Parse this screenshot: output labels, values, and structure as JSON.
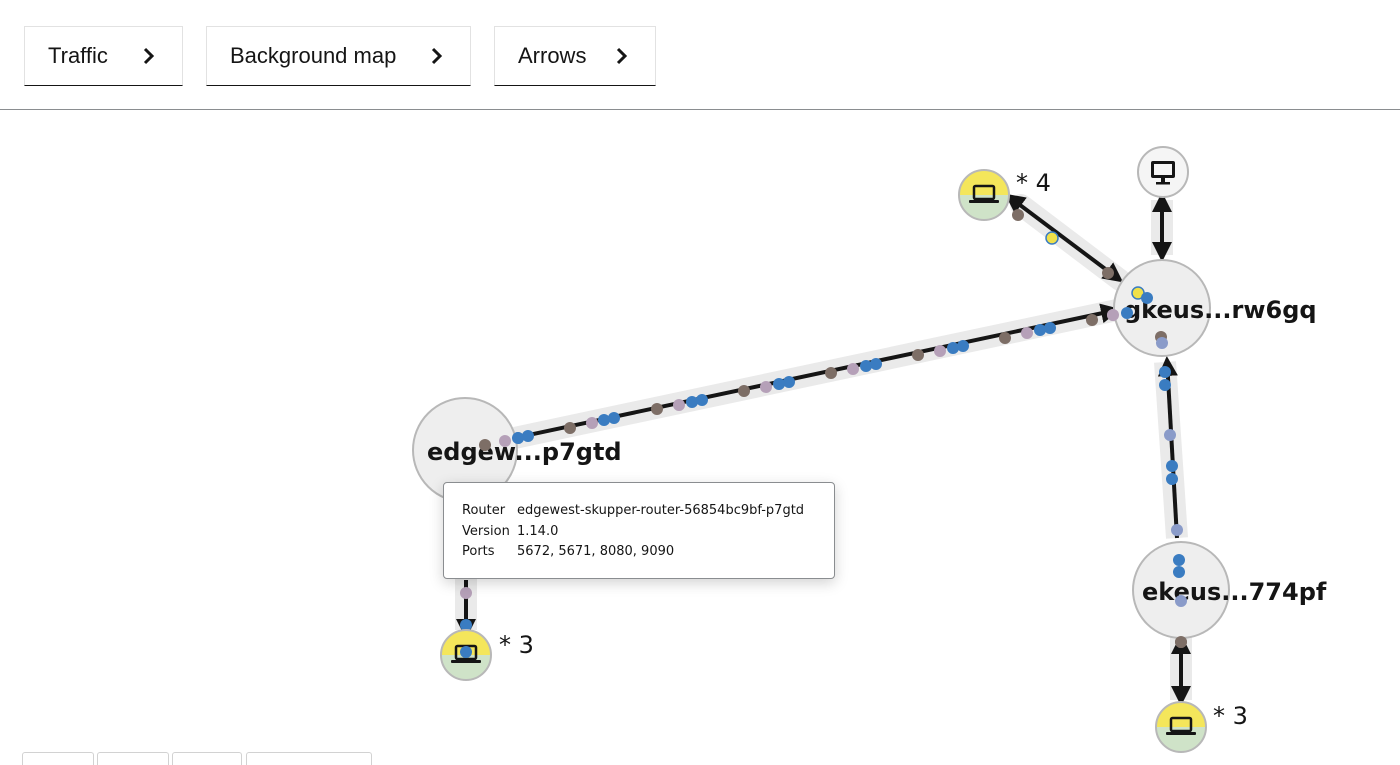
{
  "toolbar": {
    "traffic_label": "Traffic",
    "background_map_label": "Background map",
    "arrows_label": "Arrows"
  },
  "topology": {
    "routers": [
      {
        "id": "edgewest",
        "label": "edgew...p7gtd"
      },
      {
        "id": "gkeus",
        "label": "gkeus...rw6gq"
      },
      {
        "id": "ekeus",
        "label": "ekeus...774pf"
      }
    ],
    "client_groups": [
      {
        "id": "clients-gkeus",
        "count_label": "* 4"
      },
      {
        "id": "clients-edgewest",
        "count_label": "* 3"
      },
      {
        "id": "clients-ekeus",
        "count_label": "* 3"
      }
    ],
    "console": {
      "id": "console",
      "icon": "monitor-icon"
    }
  },
  "tooltip": {
    "router_key": "Router",
    "router_value": "edgewest-skupper-router-56854bc9bf-p7gtd",
    "version_key": "Version",
    "version_value": "1.14.0",
    "ports_key": "Ports",
    "ports_value": "5672, 5671, 8080, 9090"
  },
  "colors": {
    "router_fill": "#eeeeee",
    "router_stroke": "#b8b8b8",
    "client_top": "#f4e65b",
    "client_bottom": "#cfe3c8",
    "link_halo": "#eaeaea",
    "link_line": "#151515",
    "dot_blue": "#3a7cc1",
    "dot_brown": "#7d6e66",
    "dot_lilac": "#b5a0b8",
    "dot_yellow": "#efe04a"
  }
}
